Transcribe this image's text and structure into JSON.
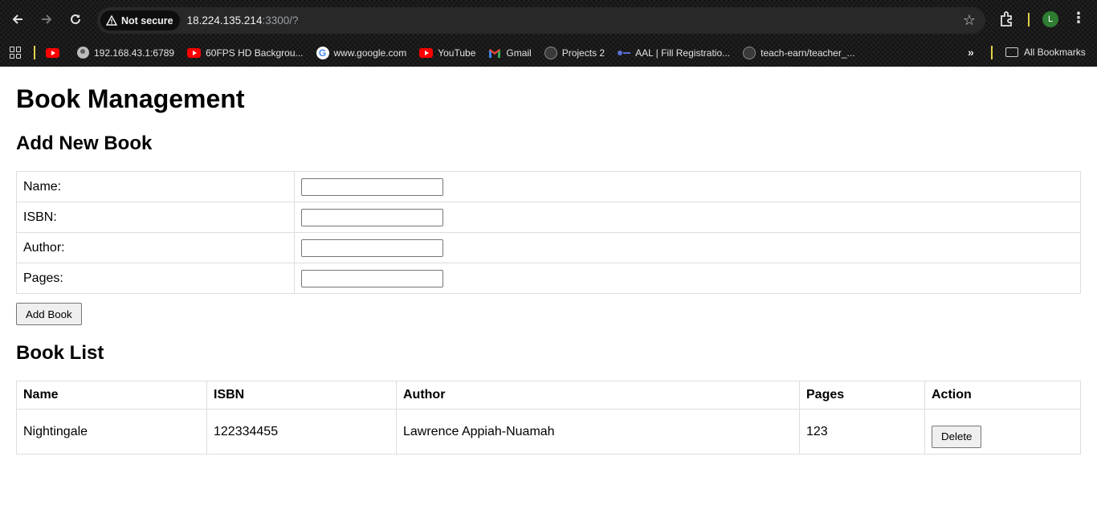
{
  "browser": {
    "security_label": "Not secure",
    "url_host": "18.224.135.214",
    "url_rest": ":3300/?",
    "profile_initial": "L",
    "bookmarks": [
      {
        "icon": "youtube-icon",
        "label": ""
      },
      {
        "icon": "globe-icon",
        "label": "192.168.43.1:6789"
      },
      {
        "icon": "youtube-icon",
        "label": "60FPS HD Backgrou..."
      },
      {
        "icon": "google-icon",
        "label": "www.google.com"
      },
      {
        "icon": "youtube-icon",
        "label": "YouTube"
      },
      {
        "icon": "gmail-icon",
        "label": "Gmail"
      },
      {
        "icon": "github-icon",
        "label": "Projects 2"
      },
      {
        "icon": "aal-icon",
        "label": "AAL | Fill Registratio..."
      },
      {
        "icon": "github-icon",
        "label": "teach-earn/teacher_..."
      }
    ],
    "all_bookmarks_label": "All Bookmarks"
  },
  "page": {
    "title": "Book Management",
    "add_section_title": "Add New Book",
    "form": {
      "name_label": "Name:",
      "isbn_label": "ISBN:",
      "author_label": "Author:",
      "pages_label": "Pages:",
      "name_value": "",
      "isbn_value": "",
      "author_value": "",
      "pages_value": "",
      "submit_label": "Add Book"
    },
    "list_section_title": "Book List",
    "table": {
      "headers": [
        "Name",
        "ISBN",
        "Author",
        "Pages",
        "Action"
      ],
      "rows": [
        {
          "name": "Nightingale",
          "isbn": "122334455",
          "author": "Lawrence Appiah-Nuamah",
          "pages": "123",
          "action_label": "Delete"
        }
      ]
    }
  }
}
